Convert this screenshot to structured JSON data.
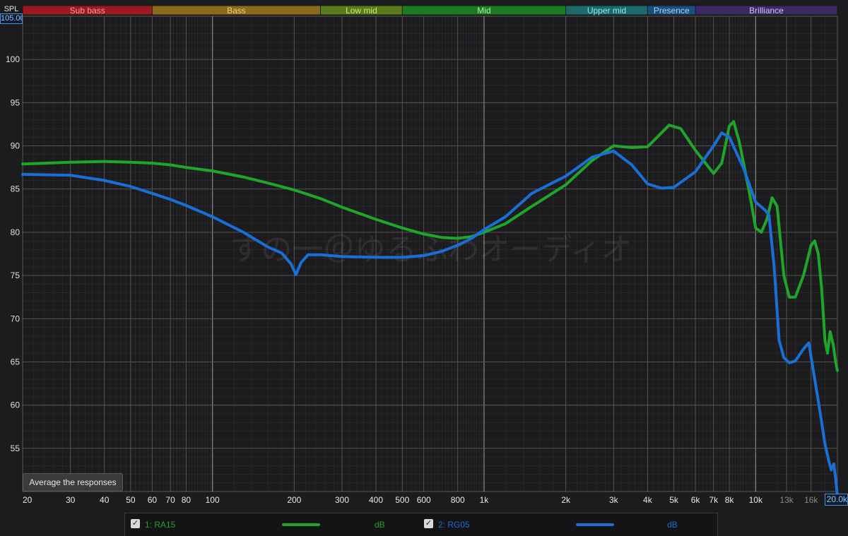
{
  "bands": [
    {
      "label": "Sub bass",
      "from": 20,
      "to": 60,
      "color": "#9b1a22",
      "text": "#ff9a9a"
    },
    {
      "label": "Bass",
      "from": 60,
      "to": 250,
      "color": "#8a6a1c",
      "text": "#f0d070"
    },
    {
      "label": "Low mid",
      "from": 250,
      "to": 500,
      "color": "#5a7a1c",
      "text": "#c8ee70"
    },
    {
      "label": "Mid",
      "from": 500,
      "to": 2000,
      "color": "#1c7a26",
      "text": "#a8f0a8"
    },
    {
      "label": "Upper mid",
      "from": 2000,
      "to": 4000,
      "color": "#1c6a6a",
      "text": "#90e8e8"
    },
    {
      "label": "Presence",
      "from": 4000,
      "to": 6000,
      "color": "#1c4f7f",
      "text": "#a8d0ff"
    },
    {
      "label": "Brilliance",
      "from": 6000,
      "to": 20000,
      "color": "#3a2a66",
      "text": "#d0c0ff"
    }
  ],
  "y_unit": "SPL",
  "y_top_value": "105.00",
  "x_max_value": "20.0k",
  "average_button": "Average the responses",
  "watermark": "すの一＠ゆるふわオーディオ",
  "colors": {
    "background": "#1c1c1e",
    "grid_major": "#5a5a5a",
    "grid_minor": "#333336",
    "series1": "#1fa52a",
    "series2": "#1a6fd6"
  },
  "legend": [
    {
      "checked": true,
      "check_mark": "✓",
      "label": "1: RA15",
      "unit": "dB",
      "color": "#1fa52a"
    },
    {
      "checked": true,
      "check_mark": "✓",
      "label": "2: RG05",
      "unit": "dB",
      "color": "#1a6fd6"
    }
  ],
  "chart_data": {
    "type": "line",
    "xscale": "log",
    "xlim": [
      20,
      20000
    ],
    "ylim": [
      50,
      105
    ],
    "grid": true,
    "legend_position": "bottom",
    "x_ticks": [
      {
        "value": 20,
        "label": "20",
        "dim": false
      },
      {
        "value": 30,
        "label": "30",
        "dim": false
      },
      {
        "value": 40,
        "label": "40",
        "dim": false
      },
      {
        "value": 50,
        "label": "50",
        "dim": false
      },
      {
        "value": 60,
        "label": "60",
        "dim": false
      },
      {
        "value": 70,
        "label": "70",
        "dim": false
      },
      {
        "value": 80,
        "label": "80",
        "dim": false
      },
      {
        "value": 100,
        "label": "100",
        "dim": false
      },
      {
        "value": 200,
        "label": "200",
        "dim": false
      },
      {
        "value": 300,
        "label": "300",
        "dim": false
      },
      {
        "value": 400,
        "label": "400",
        "dim": false
      },
      {
        "value": 500,
        "label": "500",
        "dim": false
      },
      {
        "value": 600,
        "label": "600",
        "dim": false
      },
      {
        "value": 800,
        "label": "800",
        "dim": false
      },
      {
        "value": 1000,
        "label": "1k",
        "dim": false
      },
      {
        "value": 2000,
        "label": "2k",
        "dim": false
      },
      {
        "value": 3000,
        "label": "3k",
        "dim": false
      },
      {
        "value": 4000,
        "label": "4k",
        "dim": false
      },
      {
        "value": 5000,
        "label": "5k",
        "dim": false
      },
      {
        "value": 6000,
        "label": "6k",
        "dim": false
      },
      {
        "value": 7000,
        "label": "7k",
        "dim": false
      },
      {
        "value": 8000,
        "label": "8k",
        "dim": false
      },
      {
        "value": 10000,
        "label": "10k",
        "dim": false
      },
      {
        "value": 13000,
        "label": "13k",
        "dim": true
      },
      {
        "value": 16000,
        "label": "16k",
        "dim": true
      }
    ],
    "y_ticks": [
      55,
      60,
      65,
      70,
      75,
      80,
      85,
      90,
      95,
      100
    ],
    "series": [
      {
        "name": "1: RA15",
        "color": "#1fa52a",
        "points": [
          [
            20,
            87.9
          ],
          [
            30,
            88.1
          ],
          [
            40,
            88.2
          ],
          [
            50,
            88.1
          ],
          [
            60,
            88.0
          ],
          [
            70,
            87.8
          ],
          [
            80,
            87.5
          ],
          [
            100,
            87.1
          ],
          [
            130,
            86.4
          ],
          [
            160,
            85.7
          ],
          [
            200,
            84.9
          ],
          [
            250,
            83.9
          ],
          [
            300,
            82.9
          ],
          [
            400,
            81.5
          ],
          [
            500,
            80.5
          ],
          [
            600,
            79.8
          ],
          [
            700,
            79.4
          ],
          [
            800,
            79.3
          ],
          [
            900,
            79.5
          ],
          [
            1000,
            80.0
          ],
          [
            1200,
            81.0
          ],
          [
            1500,
            83.0
          ],
          [
            2000,
            85.5
          ],
          [
            2500,
            88.3
          ],
          [
            3000,
            90.0
          ],
          [
            3500,
            89.8
          ],
          [
            4000,
            89.9
          ],
          [
            4500,
            91.5
          ],
          [
            4800,
            92.4
          ],
          [
            5300,
            92.0
          ],
          [
            6000,
            89.5
          ],
          [
            7000,
            86.8
          ],
          [
            7500,
            88.0
          ],
          [
            8000,
            92.3
          ],
          [
            8300,
            92.8
          ],
          [
            8700,
            90.5
          ],
          [
            9500,
            84.5
          ],
          [
            10000,
            80.5
          ],
          [
            10500,
            80.0
          ],
          [
            11000,
            81.5
          ],
          [
            11500,
            84.0
          ],
          [
            12000,
            83.0
          ],
          [
            12700,
            75.0
          ],
          [
            13300,
            72.5
          ],
          [
            14000,
            72.5
          ],
          [
            15000,
            75.0
          ],
          [
            16000,
            78.5
          ],
          [
            16500,
            79.0
          ],
          [
            17000,
            77.5
          ],
          [
            17500,
            73.5
          ],
          [
            18000,
            67.5
          ],
          [
            18400,
            66.0
          ],
          [
            18800,
            68.5
          ],
          [
            19300,
            67.0
          ],
          [
            19700,
            65.0
          ],
          [
            20000,
            64.0
          ]
        ]
      },
      {
        "name": "2: RG05",
        "color": "#1a6fd6",
        "points": [
          [
            20,
            86.7
          ],
          [
            30,
            86.6
          ],
          [
            40,
            86.0
          ],
          [
            50,
            85.3
          ],
          [
            60,
            84.5
          ],
          [
            70,
            83.8
          ],
          [
            80,
            83.1
          ],
          [
            100,
            81.8
          ],
          [
            130,
            80.0
          ],
          [
            160,
            78.3
          ],
          [
            180,
            77.6
          ],
          [
            195,
            76.3
          ],
          [
            203,
            75.1
          ],
          [
            212,
            76.5
          ],
          [
            225,
            77.4
          ],
          [
            250,
            77.4
          ],
          [
            300,
            77.2
          ],
          [
            400,
            77.1
          ],
          [
            500,
            77.1
          ],
          [
            600,
            77.3
          ],
          [
            700,
            77.8
          ],
          [
            800,
            78.5
          ],
          [
            900,
            79.3
          ],
          [
            1000,
            80.3
          ],
          [
            1200,
            81.8
          ],
          [
            1500,
            84.5
          ],
          [
            2000,
            86.5
          ],
          [
            2500,
            88.7
          ],
          [
            3000,
            89.4
          ],
          [
            3500,
            87.8
          ],
          [
            4000,
            85.6
          ],
          [
            4500,
            85.1
          ],
          [
            5000,
            85.2
          ],
          [
            6000,
            87.0
          ],
          [
            7000,
            90.0
          ],
          [
            7500,
            91.5
          ],
          [
            8000,
            91.0
          ],
          [
            9000,
            87.5
          ],
          [
            10000,
            83.5
          ],
          [
            10800,
            82.6
          ],
          [
            11200,
            82.0
          ],
          [
            11700,
            76.0
          ],
          [
            12200,
            67.5
          ],
          [
            12700,
            65.5
          ],
          [
            13300,
            64.9
          ],
          [
            14000,
            65.1
          ],
          [
            15000,
            66.5
          ],
          [
            15700,
            67.2
          ],
          [
            16300,
            64.0
          ],
          [
            17000,
            60.5
          ],
          [
            17500,
            58.0
          ],
          [
            18000,
            55.5
          ],
          [
            18600,
            53.5
          ],
          [
            19000,
            52.5
          ],
          [
            19400,
            53.2
          ],
          [
            19700,
            51.5
          ],
          [
            20000,
            49.5
          ]
        ]
      }
    ]
  }
}
